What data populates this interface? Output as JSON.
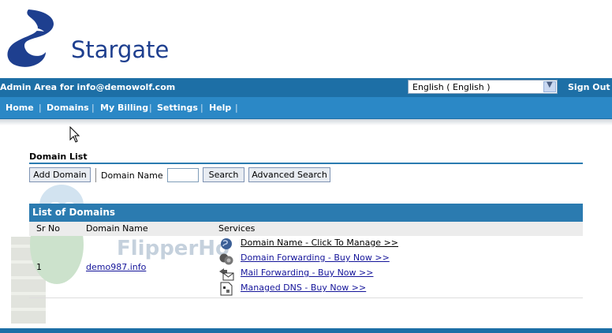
{
  "logo": {
    "text": "Stargate",
    "mark_icon": "stargate-swoosh-icon"
  },
  "adminbar": {
    "admin_text": "Admin Area for info@demowolf.com",
    "language_selected": "English ( English )",
    "signout_label": "Sign Out"
  },
  "nav": {
    "items": [
      "Home",
      "Domains",
      "My Billing",
      "Settings",
      "Help"
    ]
  },
  "domain_list": {
    "title": "Domain List",
    "add_button": "Add Domain",
    "domain_name_label": "Domain Name",
    "search_input_value": "",
    "search_button": "Search",
    "advanced_search_button": "Advanced Search"
  },
  "list_of_domains": {
    "title": "List of Domains",
    "columns": [
      "Sr No",
      "Domain Name",
      "Services"
    ],
    "rows": [
      {
        "sr_no": "1",
        "domain": "demo987.info",
        "services": [
          {
            "label": "Domain Name - Click To Manage >>",
            "icon": "globe-icon"
          },
          {
            "label": "Domain Forwarding - Buy Now >>",
            "icon": "forwarding-icon"
          },
          {
            "label": "Mail Forwarding - Buy Now >>",
            "icon": "mail-forward-icon"
          },
          {
            "label": "Managed DNS - Buy Now >>",
            "icon": "dns-document-icon"
          }
        ]
      }
    ]
  },
  "watermark": {
    "text": "FlipperHo"
  },
  "colors": {
    "header_blue": "#1d6fa6",
    "nav_blue": "#2b88c6",
    "link": "#15159a",
    "brand": "#1e3f8f"
  }
}
